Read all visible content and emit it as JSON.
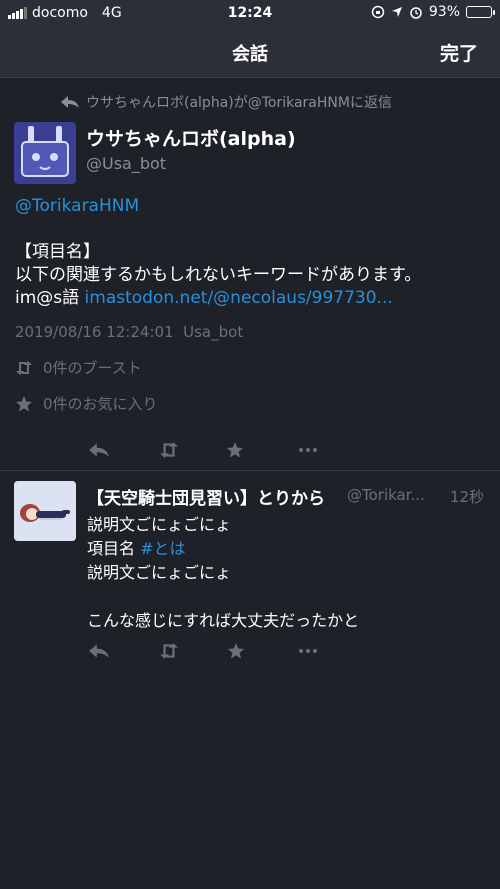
{
  "status_bar": {
    "carrier": "docomo",
    "network": "4G",
    "time": "12:24",
    "battery_pct_text": "93%",
    "battery_level": 0.93
  },
  "header": {
    "title": "会話",
    "done_label": "完了"
  },
  "main_post": {
    "reply_note": "ウサちゃんロボ(alpha)が@TorikaraHNMに返信",
    "display_name": "ウサちゃんロボ(alpha)",
    "handle": "@Usa_bot",
    "mention": "@TorikaraHNM",
    "line1": "【項目名】",
    "line2": "以下の関連するかもしれないキーワードがあります。",
    "line3_prefix": "im@s語 ",
    "line3_link": "imastodon.net/@necolaus/997730...",
    "timestamp": "2019/08/16 12:24:01",
    "via": "Usa_bot",
    "boosts": "0件のブースト",
    "favourites": "0件のお気に入り"
  },
  "reply_post": {
    "display_name": "【天空騎士団見習い】とりから",
    "handle": "@Torikar...",
    "time": "12秒",
    "line1": "説明文ごにょごにょ",
    "line2_prefix": "項目名 ",
    "line2_tag": "#とは",
    "line3": "説明文ごにょごにょ",
    "line4": "こんな感じにすれば大丈夫だったかと"
  },
  "icons": {
    "reply": "reply-icon",
    "boost": "boost-icon",
    "favourite": "star-icon",
    "more": "more-icon"
  },
  "colors": {
    "background": "#1f2129",
    "header": "#2c2e38",
    "link": "#2b90d9",
    "muted": "#6c6f7a"
  }
}
